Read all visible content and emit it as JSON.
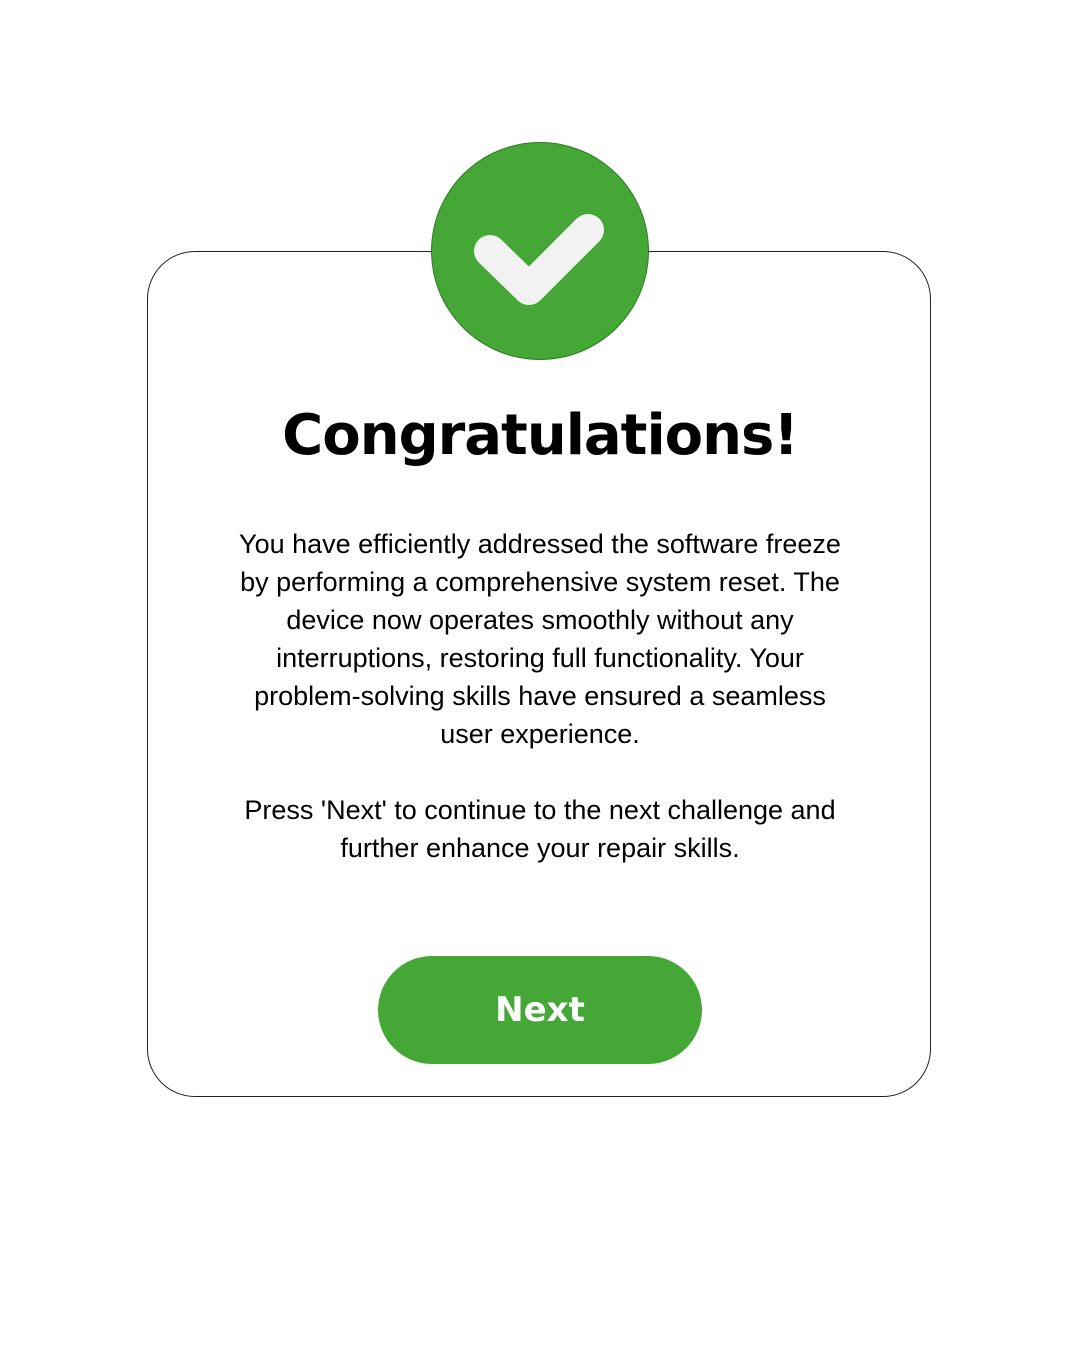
{
  "dialog": {
    "title": "Congratulations!",
    "message": "You have efficiently addressed the software freeze\nby performing a comprehensive system reset. The\ndevice now operates smoothly without any\ninterruptions, restoring full functionality. Your\nproblem-solving skills have ensured a seamless\nuser experience.\n\nPress 'Next' to continue to the next challenge and\nfurther enhance your repair skills.",
    "next_label": "Next",
    "icon": "checkmark-icon"
  },
  "colors": {
    "accent": "#45a836",
    "check": "#f2f2f2",
    "text": "#000000",
    "background": "#ffffff"
  }
}
